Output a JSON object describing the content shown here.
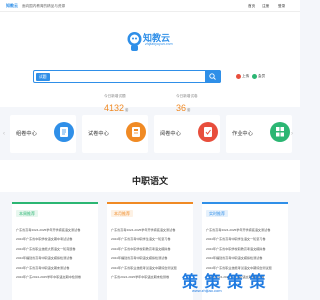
{
  "topbar": {
    "brand": "知教云",
    "desc": "面向国内教育的精品与资源",
    "right_links": [
      "首页",
      "注册",
      "登录"
    ]
  },
  "logo": {
    "title": "知教云",
    "subtitle": "zhijiaoyuyun.com"
  },
  "search": {
    "tag": "试题",
    "placeholder": ""
  },
  "actions": {
    "upload": "上传",
    "member": "会员"
  },
  "stats": [
    {
      "label": "今日新增试题",
      "value": "4132",
      "unit": "套"
    },
    {
      "label": "今日新增试卷",
      "value": "36",
      "unit": "套"
    }
  ],
  "cards": [
    {
      "label": "组卷中心",
      "icon": "document-icon",
      "color": "#2f8fe8"
    },
    {
      "label": "试卷中心",
      "icon": "exam-icon",
      "color": "#f08a24"
    },
    {
      "label": "阅卷中心",
      "icon": "review-icon",
      "color": "#e84e3c"
    },
    {
      "label": "作业中心",
      "icon": "homework-icon",
      "color": "#2bb673"
    }
  ],
  "subject": {
    "title": "中职语文"
  },
  "panels": [
    {
      "title": "本周推荐",
      "color": "#2bb673",
      "items": [
        "广东省高考2024-2025学年开学摸底语文测试卷",
        "2024年广东省中职学校语文期中考试试卷",
        "2024年广东省职业技能大赛语文一轮真题卷",
        "2024年福建省高考中职语文模拟检测试卷",
        "2024年广东省高考中职语文期末测试卷",
        "2024年广东2024-2025学年中职语文期中检测卷"
      ]
    },
    {
      "title": "本月推荐",
      "color": "#f08a24",
      "items": [
        "广东省高考2024-2025学年开学摸底语文测试卷",
        "2024年广东省高考中职学生语文一轮复习卷",
        "2024年广东省中职学校职教高考语文模拟卷",
        "2024年福建省高考中职语文模拟检测试卷",
        "2024年广东省职业技能考试语文中期综合测试题",
        "广东省2024-2025学年中职语文期末检测卷"
      ]
    },
    {
      "title": "实时推荐",
      "color": "#2f8fe8",
      "items": [
        "广东省高考2024-2025学年开学摸底语文测试卷",
        "2024年广东省高考中职学生语文一轮复习卷",
        "2024年广东省中职学校职教高考语文模拟卷",
        "2024年福建省高考中职语文模拟检测试卷",
        "2024年广东省职业技能考试语文中期综合测试题",
        "广东省2024-2025学年中职语文期末检测卷"
      ]
    }
  ],
  "watermark": {
    "text": "策 策 策 策",
    "sub": "www.zhijiao.com"
  }
}
